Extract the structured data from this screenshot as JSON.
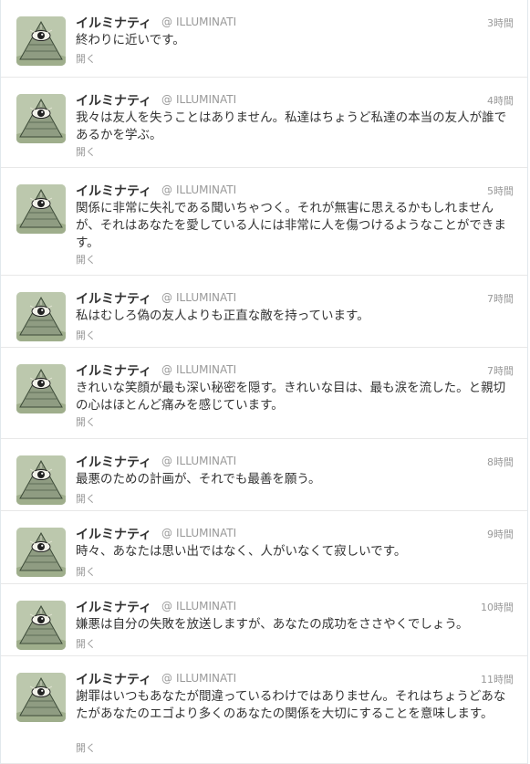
{
  "account": {
    "display_name": "イルミナティ",
    "at": "@",
    "handle": "ILLUMINATI"
  },
  "open_label": "開く",
  "colors": {
    "name": "#333333",
    "meta": "#999999",
    "divider": "#e8e8e8"
  },
  "tweets": [
    {
      "time": "3時間",
      "text": "終わりに近いです。"
    },
    {
      "time": "4時間",
      "text": "我々は友人を失うことはありません。私達はちょうど私達の本当の友人が誰であるかを学ぶ。"
    },
    {
      "time": "5時間",
      "text": "関係に非常に失礼である聞いちゃつく。それが無害に思えるかもしれませんが、それはあなたを愛している人には非常に人を傷つけるようなことができます。"
    },
    {
      "time": "7時間",
      "text": "私はむしろ偽の友人よりも正直な敵を持っています。"
    },
    {
      "time": "7時間",
      "text": "きれいな笑顔が最も深い秘密を隠す。きれいな目は、最も涙を流した。と親切の心はほとんど痛みを感じています。"
    },
    {
      "time": "8時間",
      "text": "最悪のための計画が、それでも最善を願う。"
    },
    {
      "time": "9時間",
      "text": "時々、あなたは思い出ではなく、人がいなくて寂しいです。"
    },
    {
      "time": "10時間",
      "text": "嫌悪は自分の失敗を放送しますが、あなたの成功をささやくでしょう。"
    },
    {
      "time": "11時間",
      "text": "謝罪はいつもあなたが間違っているわけではありません。それはちょうどあなたがあなたのエゴより多くのあなたの関係を大切にすることを意味します。"
    }
  ]
}
